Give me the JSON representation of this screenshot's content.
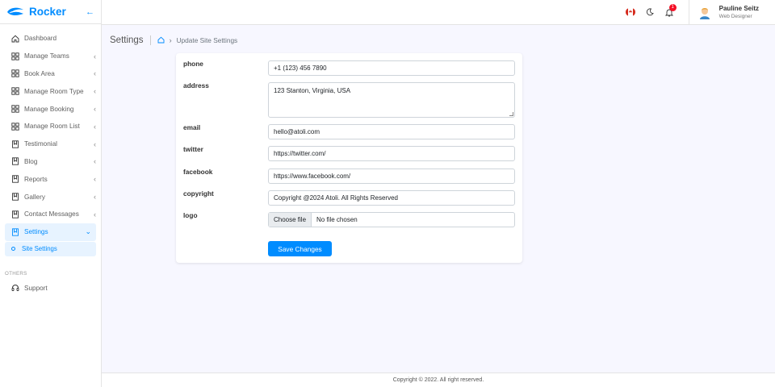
{
  "brand": {
    "name": "Rocker"
  },
  "sidebar": {
    "items": [
      {
        "label": "Dashboard",
        "icon": "home-icon",
        "chevron": false
      },
      {
        "label": "Manage Teams",
        "icon": "grid-icon",
        "chevron": true
      },
      {
        "label": "Book Area",
        "icon": "grid-icon",
        "chevron": true
      },
      {
        "label": "Manage Room Type",
        "icon": "grid-icon",
        "chevron": true
      },
      {
        "label": "Manage Booking",
        "icon": "grid-icon",
        "chevron": true
      },
      {
        "label": "Manage Room List",
        "icon": "grid-icon",
        "chevron": true
      },
      {
        "label": "Testimonial",
        "icon": "bookmark-icon",
        "chevron": true
      },
      {
        "label": "Blog",
        "icon": "bookmark-icon",
        "chevron": true
      },
      {
        "label": "Reports",
        "icon": "bookmark-icon",
        "chevron": true
      },
      {
        "label": "Gallery",
        "icon": "bookmark-icon",
        "chevron": true
      },
      {
        "label": "Contact Messages",
        "icon": "bookmark-icon",
        "chevron": true
      },
      {
        "label": "Settings",
        "icon": "bookmark-icon",
        "chevron": true
      }
    ],
    "submenu": {
      "label": "Site Settings"
    },
    "section_label": "OTHERS",
    "support": {
      "label": "Support",
      "icon": "headset-icon"
    }
  },
  "topbar": {
    "notification_count": "1",
    "user": {
      "name": "Pauline Seitz",
      "role": "Web Designer"
    }
  },
  "breadcrumb": {
    "title": "Settings",
    "current": "Update Site Settings"
  },
  "form": {
    "phone": {
      "label": "phone",
      "value": "+1 (123) 456 7890"
    },
    "address": {
      "label": "address",
      "value": "123 Stanton, Virginia, USA"
    },
    "email": {
      "label": "email",
      "value": "hello@atoli.com"
    },
    "twitter": {
      "label": "twitter",
      "value": "https://twitter.com/"
    },
    "facebook": {
      "label": "facebook",
      "value": "https://www.facebook.com/"
    },
    "copyright": {
      "label": "copyright",
      "value": "Copyright @2024 Atoli. All Rights Reserved"
    },
    "logo": {
      "label": "logo",
      "button": "Choose file",
      "status": "No file chosen"
    },
    "save_label": "Save Changes"
  },
  "footer": {
    "text": "Copyright © 2022. All right reserved."
  },
  "colors": {
    "accent": "#008cff",
    "badge": "#f41127"
  }
}
